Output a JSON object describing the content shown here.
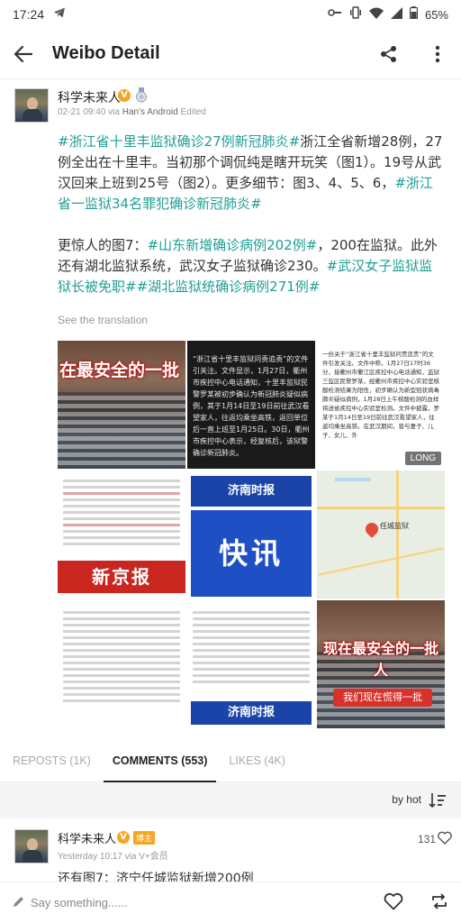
{
  "status_bar": {
    "time": "17:24",
    "battery": "65%"
  },
  "app_bar": {
    "title": "Weibo Detail"
  },
  "post": {
    "author": "科学未来人",
    "verified_badge": "V",
    "timestamp": "02-21 09:40",
    "via_label": "via",
    "source": "Han's Android",
    "edited": "Edited",
    "para1": [
      {
        "t": "#浙江省十里丰监狱确诊27例新冠肺炎#",
        "tag": true
      },
      {
        "t": "浙江全省新增28例，27例全出在十里丰。当初那个调侃纯是瞎开玩笑（图1）。19号从武汉回来上班到25号（图2）。更多细节：图3、4、5、6，",
        "tag": false
      },
      {
        "t": "#浙江省一监狱34名罪犯确诊新冠肺炎#",
        "tag": true
      }
    ],
    "para2": [
      {
        "t": "更惊人的图7：",
        "tag": false
      },
      {
        "t": "#山东新增确诊病例202例#",
        "tag": true
      },
      {
        "t": "，200在监狱。此外还有湖北监狱系统，武汉女子监狱确诊230。",
        "tag": false
      },
      {
        "t": "#武汉女子监狱监狱长被免职#",
        "tag": true
      },
      {
        "t": "#湖北监狱统确诊病例271例#",
        "tag": true
      }
    ],
    "translate": "See the translation",
    "images": {
      "img1_caption": "在最安全的一批",
      "img2_text": "“浙江省十里丰监狱问责追责”的文件引关注。文件显示，1月27日，衢州市疾控中心电话通知，十里丰监狱民警罗某被初步确认为新冠肺炎疑似病例，其于1月14日至19日前往武汉看望家人，往返均乘坐高铁，返回单位后一直上班至1月25日。30日，衢州市疾控中心表示，经复核后，该狱警确诊新冠肺炎。",
      "img3_text": "一份关于“浙江省十里丰监狱问责追责”的文件引发关注。文件中称，1月27日17时36分，接衢州市衢江区疾控中心电话通知，监狱三监区民警罗某，经衢州市疾控中心实验室核酸检测结果为阳性，初步确认为新型冠状病毒肺炎疑似病例，1月28日上午核酸检测的血样将送省疾控中心实验室检测。文件中披露，罗某于1月14日至19日前往武汉看望家人，往返均乘坐高铁。在武汉期间，曾与妻子、儿子、女儿、外",
      "img3_badge": "LONG",
      "img4_banner": "新京报",
      "img5_head": "济南时报",
      "img5_kx": "快讯",
      "img6_pin": "任城监狱",
      "img9_caption": "现在最安全的一批人",
      "img9_button": "我们现在慌得一批"
    }
  },
  "tabs": [
    {
      "label": "REPOSTS (1K)",
      "active": false
    },
    {
      "label": "COMMENTS (553)",
      "active": true
    },
    {
      "label": "LIKES (4K)",
      "active": false
    }
  ],
  "sort": {
    "label": "by hot"
  },
  "comment": {
    "author": "科学未来人",
    "host_badge": "博主",
    "timestamp": "Yesterday 10:17 via V+会员",
    "likes": "131",
    "text": "还有图7：济宁任城监狱新增200例"
  },
  "input_bar": {
    "placeholder": "Say something......"
  }
}
